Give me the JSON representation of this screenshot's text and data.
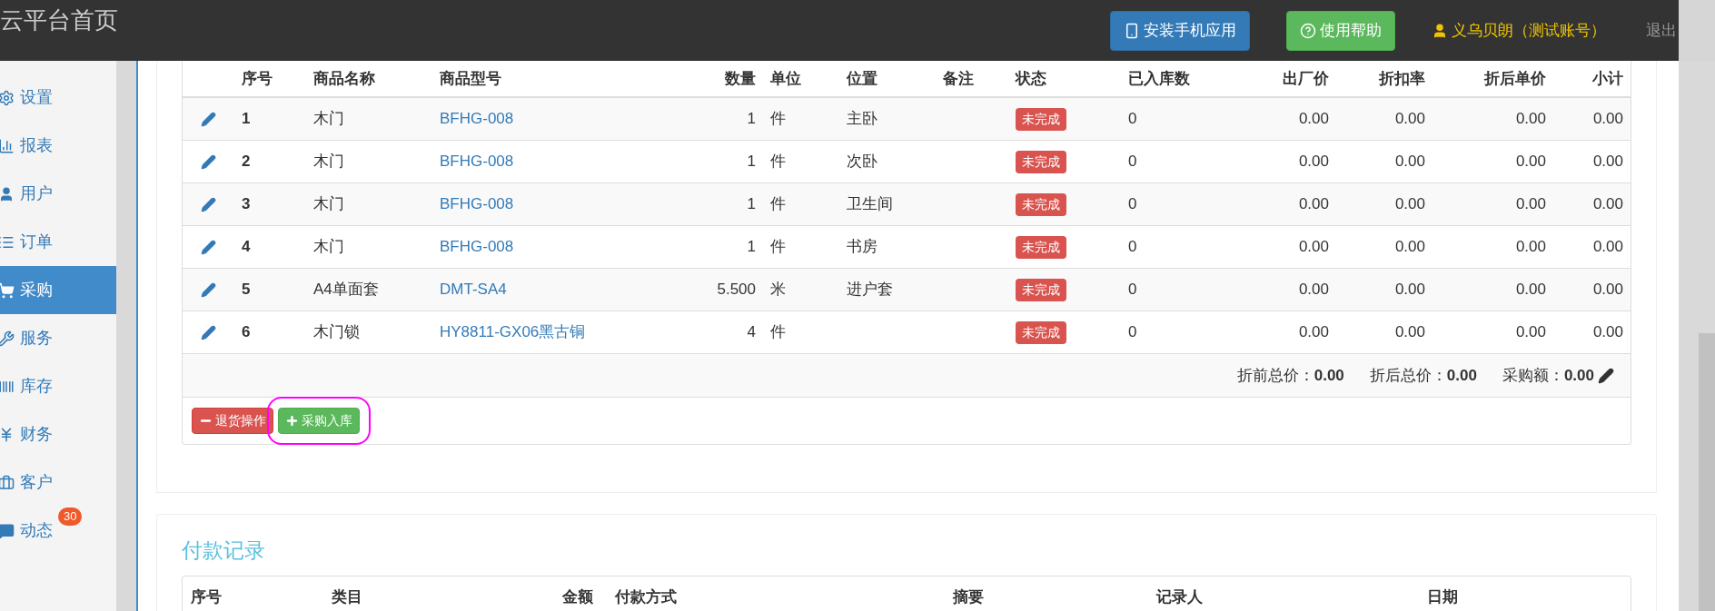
{
  "header": {
    "title": "云平台首页",
    "buttons": [
      {
        "label": "安装手机应用",
        "kind": "app"
      },
      {
        "label": "使用帮助",
        "kind": "help"
      }
    ],
    "user": "义乌贝朗（测试账号）",
    "logout": "退出"
  },
  "sidebar": {
    "items": [
      {
        "label": "设置",
        "kind": "gear",
        "selected": false
      },
      {
        "label": "报表",
        "kind": "chart",
        "selected": false
      },
      {
        "label": "用户",
        "kind": "user",
        "selected": false
      },
      {
        "label": "订单",
        "kind": "list",
        "selected": false
      },
      {
        "label": "采购",
        "kind": "cart",
        "selected": true
      },
      {
        "label": "服务",
        "kind": "wrench",
        "selected": false
      },
      {
        "label": "库存",
        "kind": "barcode",
        "selected": false
      },
      {
        "label": "财务",
        "kind": "yen",
        "selected": false
      },
      {
        "label": "客户",
        "kind": "briefcase",
        "selected": false
      },
      {
        "label": "动态",
        "kind": "comment",
        "selected": false,
        "badge": "30"
      }
    ]
  },
  "items_table": {
    "columns": [
      "序号",
      "商品名称",
      "商品型号",
      "数量",
      "单位",
      "位置",
      "备注",
      "状态",
      "已入库数",
      "出厂价",
      "折扣率",
      "折后单价",
      "小计"
    ],
    "rows": [
      {
        "no": "1",
        "name": "木门",
        "model": "BFHG-008",
        "qty": "1",
        "unit": "件",
        "location": "主卧",
        "status": "未完成",
        "received": "0",
        "factory_price": "0.00",
        "discount": "0.00",
        "unit_price": "0.00",
        "subtotal": "0.00"
      },
      {
        "no": "2",
        "name": "木门",
        "model": "BFHG-008",
        "qty": "1",
        "unit": "件",
        "location": "次卧",
        "status": "未完成",
        "received": "0",
        "factory_price": "0.00",
        "discount": "0.00",
        "unit_price": "0.00",
        "subtotal": "0.00"
      },
      {
        "no": "3",
        "name": "木门",
        "model": "BFHG-008",
        "qty": "1",
        "unit": "件",
        "location": "卫生间",
        "status": "未完成",
        "received": "0",
        "factory_price": "0.00",
        "discount": "0.00",
        "unit_price": "0.00",
        "subtotal": "0.00"
      },
      {
        "no": "4",
        "name": "木门",
        "model": "BFHG-008",
        "qty": "1",
        "unit": "件",
        "location": "书房",
        "status": "未完成",
        "received": "0",
        "factory_price": "0.00",
        "discount": "0.00",
        "unit_price": "0.00",
        "subtotal": "0.00"
      },
      {
        "no": "5",
        "name": "A4单面套",
        "model": "DMT-SA4",
        "qty": "5.500",
        "unit": "米",
        "location": "进户套",
        "status": "未完成",
        "received": "0",
        "factory_price": "0.00",
        "discount": "0.00",
        "unit_price": "0.00",
        "subtotal": "0.00"
      },
      {
        "no": "6",
        "name": "木门锁",
        "model": "HY8811-GX06黑古铜",
        "qty": "4",
        "unit": "件",
        "status": "未完成",
        "received": "0",
        "factory_price": "0.00",
        "discount": "0.00",
        "unit_price": "0.00",
        "subtotal": "0.00"
      }
    ],
    "totals": [
      "折前总价：**0.00**",
      "折后总价：**0.00**",
      "采购额：**0.00**"
    ],
    "actions": [
      {
        "label": "退货操作",
        "kind": "return",
        "highlighted": false
      },
      {
        "label": "采购入库",
        "kind": "stock_in",
        "highlighted": true
      }
    ]
  },
  "payments": {
    "title": "付款记录",
    "columns": [
      "序号",
      "类目",
      "金额",
      "付款方式",
      "摘要",
      "记录人",
      "日期"
    ]
  }
}
